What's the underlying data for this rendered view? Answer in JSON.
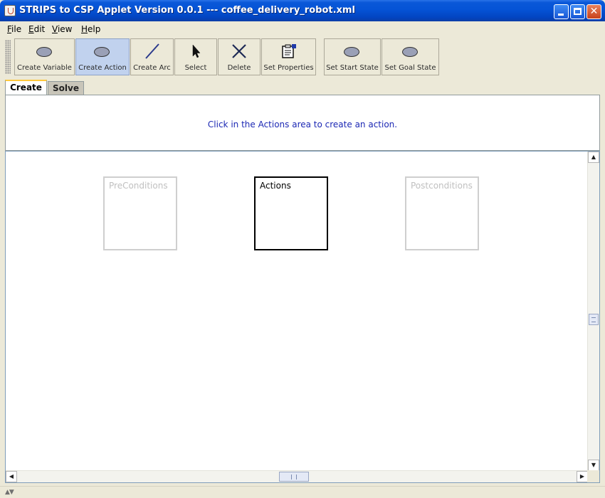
{
  "window": {
    "title": "STRIPS to CSP Applet Version 0.0.1 --- coffee_delivery_robot.xml",
    "controls": [
      "minimize-icon",
      "maximize-icon",
      "close-icon"
    ]
  },
  "menu": {
    "file": {
      "mnemonic": "F",
      "rest": "ile"
    },
    "edit": {
      "mnemonic": "E",
      "rest": "dit"
    },
    "view": {
      "mnemonic": "V",
      "rest": "iew"
    },
    "help": {
      "mnemonic": "H",
      "rest": "elp"
    }
  },
  "toolbar": {
    "create_variable": "Create Variable",
    "create_action": "Create Action",
    "create_arc": "Create Arc",
    "select": "Select",
    "delete": "Delete",
    "set_properties": "Set Properties",
    "set_start_state": "Set Start State",
    "set_goal_state": "Set Goal State",
    "active_tool": "Create Action"
  },
  "tabs": {
    "create": "Create",
    "solve": "Solve",
    "active": "Create"
  },
  "message": "Click in the Actions area to create an action.",
  "canvas": {
    "preconditions": "PreConditions",
    "actions": "Actions",
    "postconditions": "Postconditions"
  },
  "colors": {
    "titlebar": "#0553d6",
    "active_tool": "#c1d2ee",
    "message_text": "#1c28b4",
    "tab_highlight": "#ffc83c"
  }
}
